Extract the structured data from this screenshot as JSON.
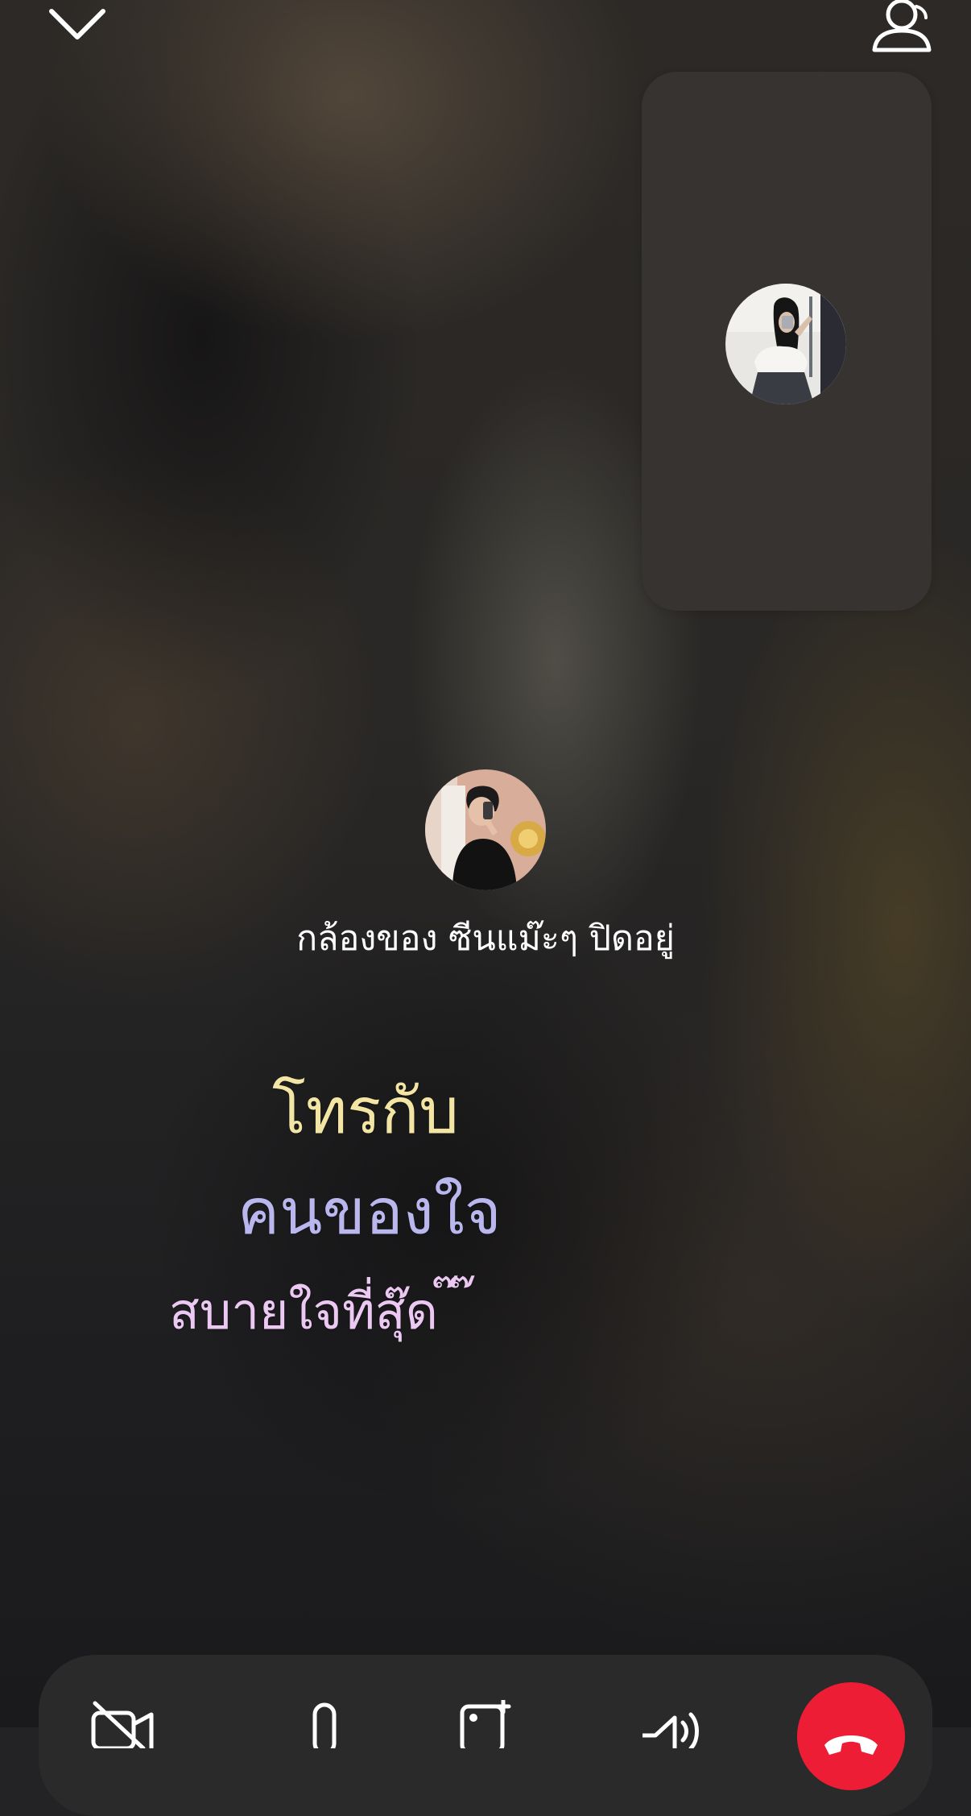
{
  "call": {
    "camera_status": "กล้องของ ซีนแม๊ะๆ ปิดอยู่"
  },
  "lyrics": {
    "line1": "โทรกับ",
    "line2": "คนของใจ",
    "line3": "สบายใจที่สุ๊ด  ๊  ๊"
  },
  "colors": {
    "lyric_line1": "#f3e6a5",
    "lyric_line2": "#b9b7ee",
    "lyric_line3": "#ecc9f3",
    "end_call": "#ee1d36"
  },
  "icons": {
    "top_left": "chevron-down-icon",
    "top_right": "people-icon",
    "toolbar": [
      "camera-off-icon",
      "microphone-icon",
      "gallery-add-icon",
      "speaker-icon",
      "end-call-icon"
    ]
  }
}
